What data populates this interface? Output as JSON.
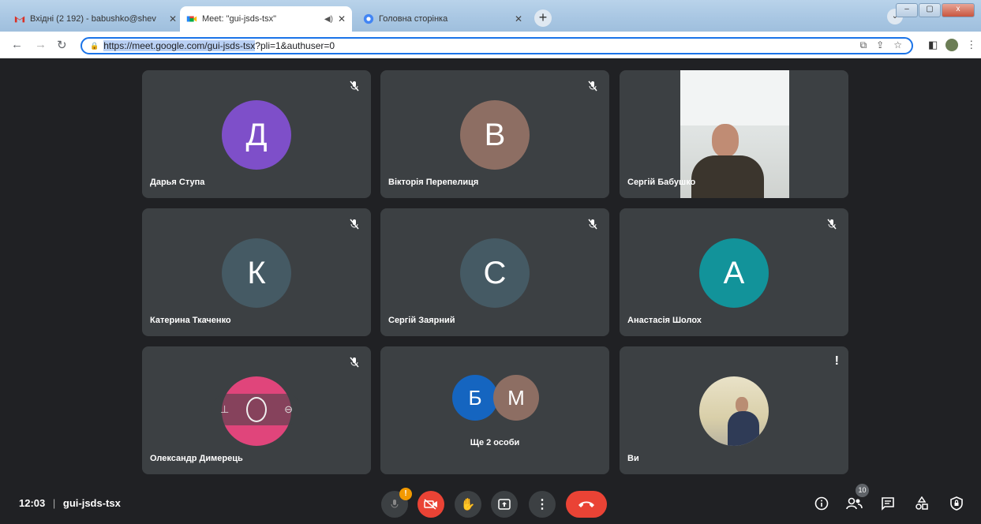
{
  "browser": {
    "tabs": [
      {
        "title": "Вхідні (2 192) - babushko@shev",
        "icon": "gmail-icon",
        "active": false
      },
      {
        "title": "Meet: \"gui-jsds-tsx\"",
        "icon": "meet-icon",
        "active": true
      },
      {
        "title": "Головна сторінка",
        "icon": "chrome-icon",
        "active": false
      }
    ],
    "close_glyph": "✕",
    "new_tab_glyph": "+",
    "url_selected": "https://meet.google.com/gui-jsds-tsx",
    "url_rest": "?pli=1&authuser=0",
    "window_buttons": [
      "–",
      "▢",
      "x"
    ]
  },
  "meeting": {
    "code": "gui-jsds-tsx",
    "time": "12:03",
    "separator": "|",
    "participant_count": "10",
    "alert_badge": "!",
    "tiles": [
      {
        "name": "Дарья Ступа",
        "initial": "Д",
        "color": "#7e4fc9",
        "muted": true
      },
      {
        "name": "Вікторія Перепелиця",
        "initial": "В",
        "color": "#8d6e63",
        "muted": true
      },
      {
        "name": "Сергій Бабушко",
        "initial": "",
        "color": "",
        "muted": false,
        "video": true
      },
      {
        "name": "Катерина Ткаченко",
        "initial": "К",
        "color": "#455a64",
        "muted": true
      },
      {
        "name": "Сергій Заярний",
        "initial": "С",
        "color": "#455a64",
        "muted": true
      },
      {
        "name": "Анастасія Шолох",
        "initial": "А",
        "color": "#12939a",
        "muted": true
      },
      {
        "name": "Олександр Димерець",
        "initial": "",
        "color": "#e0457b",
        "muted": true
      },
      {
        "name": "Ще 2 особи",
        "initials": [
          "Б",
          "М"
        ],
        "colors": [
          "#1565c0",
          "#8d6e63"
        ]
      },
      {
        "name": "Ви",
        "initial": "",
        "color": "",
        "muted": false
      }
    ],
    "you_alert": "!"
  }
}
